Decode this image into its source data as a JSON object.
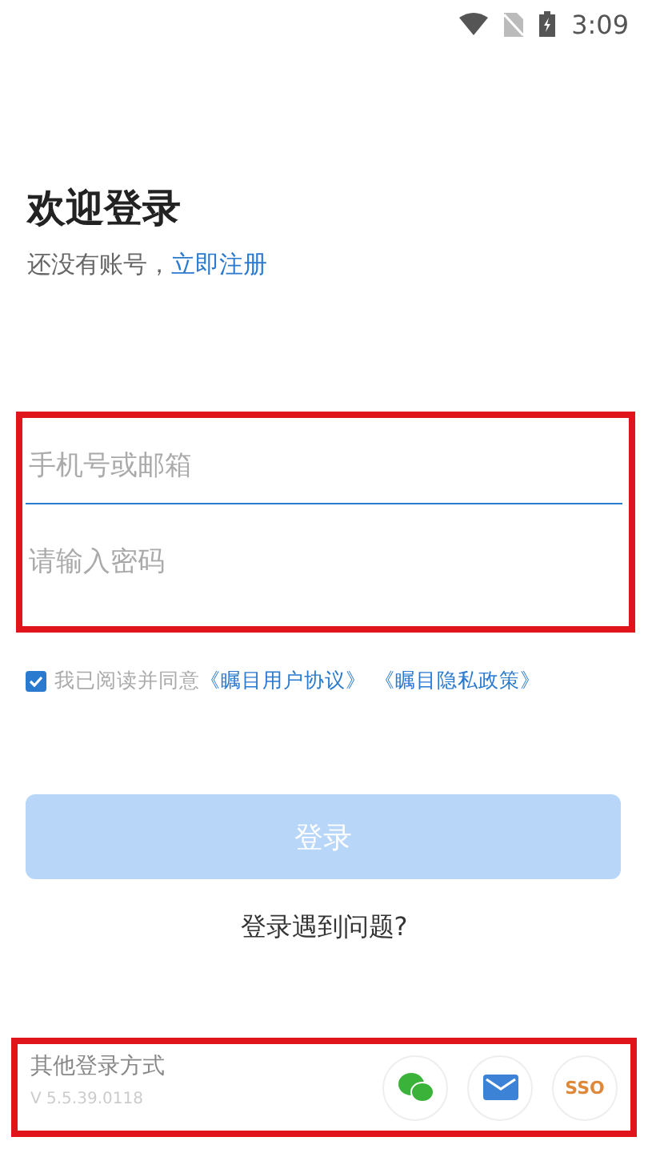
{
  "status_bar": {
    "time": "3:09"
  },
  "header": {
    "title": "欢迎登录",
    "prompt": "还没有账号，",
    "register_link": "立即注册"
  },
  "form": {
    "highlighted": true,
    "fields": [
      {
        "placeholder": "手机号或邮箱",
        "focused": true
      },
      {
        "placeholder": "请输入密码",
        "focused": false
      }
    ]
  },
  "agreement": {
    "checked": true,
    "text": "我已阅读并同意",
    "links": [
      "《瞩目用户协议》",
      "《瞩目隐私政策》"
    ]
  },
  "login_button": {
    "label": "登录",
    "disabled": true
  },
  "help_link": "登录遇到问题?",
  "other_login": {
    "highlighted": true,
    "title": "其他登录方式",
    "version": "V 5.5.39.0118",
    "methods": [
      {
        "kind": "wechat"
      },
      {
        "kind": "mail"
      },
      {
        "kind": "sso",
        "label": "SSO"
      }
    ]
  }
}
